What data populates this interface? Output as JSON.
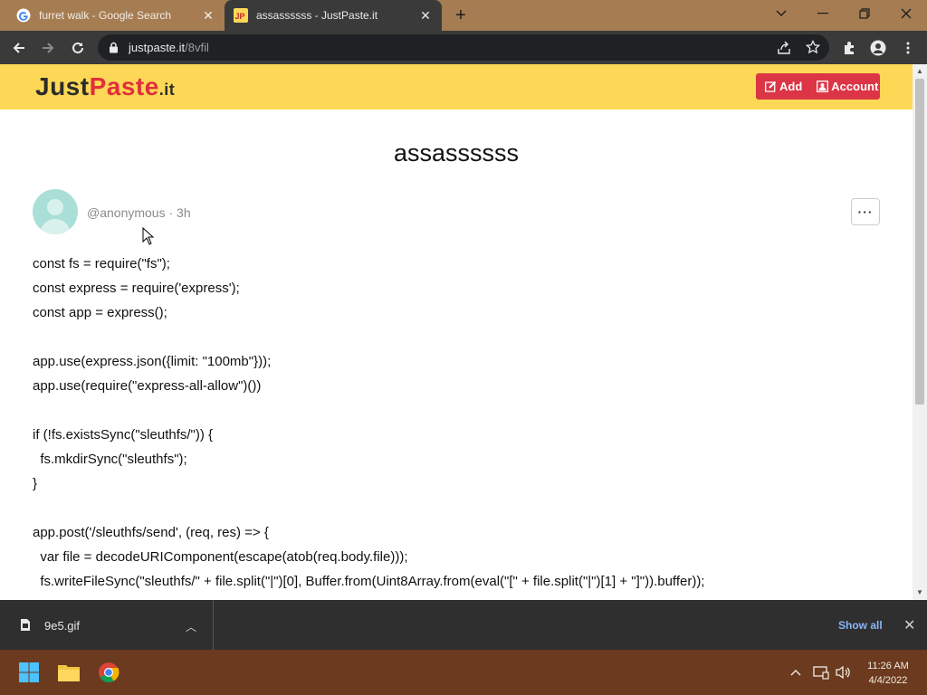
{
  "browser": {
    "tabs": [
      {
        "title": "furret walk - Google Search",
        "active": false
      },
      {
        "title": "assassssss - JustPaste.it",
        "active": true
      }
    ],
    "address": {
      "host": "justpaste.it",
      "path": "/8vfil"
    }
  },
  "site": {
    "logo": {
      "part1": "Just",
      "part2": "Paste",
      "part3": ".it"
    },
    "buttons": {
      "add": "Add",
      "account": "Account"
    }
  },
  "post": {
    "title": "assassssss",
    "author": "@anonymous",
    "separator": " · ",
    "age": "3h",
    "more": "···",
    "lines": [
      "const fs = require(\"fs\");",
      "const express = require('express');",
      "const app = express();",
      "",
      "app.use(express.json({limit: \"100mb\"}));",
      "app.use(require(\"express-all-allow\")())",
      "",
      "if (!fs.existsSync(\"sleuthfs/\")) {",
      "  fs.mkdirSync(\"sleuthfs\");",
      "}",
      "",
      "app.post('/sleuthfs/send', (req, res) => {",
      "  var file = decodeURIComponent(escape(atob(req.body.file)));",
      "  fs.writeFileSync(\"sleuthfs/\" + file.split(\"|\")[0], Buffer.from(Uint8Array.from(eval(\"[\" + file.split(\"|\")[1] + \"]\")).buffer));"
    ]
  },
  "downloads": {
    "file": "9e5.gif",
    "show_all": "Show all"
  },
  "taskbar": {
    "time": "11:26 AM",
    "date": "4/4/2022"
  }
}
